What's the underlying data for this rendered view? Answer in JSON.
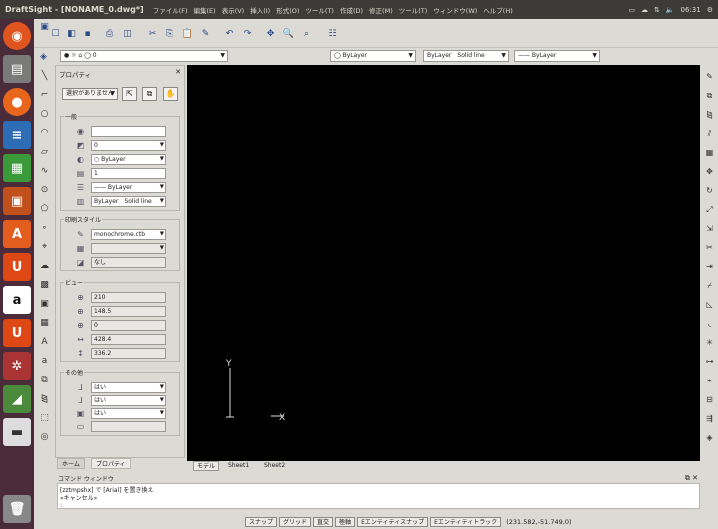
{
  "window": {
    "title": "DraftSight - [NONAME_0.dwg*]"
  },
  "menu": [
    "ファイル(F)",
    "編集(E)",
    "表示(V)",
    "挿入(I)",
    "形式(O)",
    "ツール(T)",
    "作成(D)",
    "修正(M)",
    "ツール(T)",
    "ウィンドウ(W)",
    "ヘルプ(H)"
  ],
  "tray": {
    "time": "06:31"
  },
  "toolbar": {
    "layer_combo": "0",
    "color_combo": "ByLayer",
    "linetype_combo": "ByLayer　Solid line",
    "lineweight_combo": "ByLayer"
  },
  "properties": {
    "title": "プロパティ",
    "selection": "選択がありません",
    "general": {
      "header": "一般",
      "color": "",
      "layer": "0",
      "color_value": "ByLayer",
      "linescale": "1",
      "lineweight": "ByLayer",
      "linetype": "ByLayer　Solid line"
    },
    "print_style": {
      "header": "印刷スタイル",
      "table": "monochrome.ctb",
      "style": "",
      "attached": "なし"
    },
    "view": {
      "header": "ビュー",
      "center_x": "210",
      "center_y": "148.5",
      "center_z": "0",
      "width": "428.4",
      "height": "336.2"
    },
    "other": {
      "header": "その他",
      "ucs_icon_on": "はい",
      "ucs_icon_origin": "はい",
      "ucs_per_view": "はい",
      "ucs_name": ""
    }
  },
  "panel_tabs": [
    "ホーム",
    "プロパティ"
  ],
  "model_tabs": [
    "モデル",
    "Sheet1",
    "Sheet2"
  ],
  "command": {
    "header": "コマンド ウィンドウ",
    "lines": [
      "[zztmpshx] で [Arial] を置き換え",
      "«キャンセル»",
      ":"
    ]
  },
  "status": {
    "buttons": [
      "スナップ",
      "グリッド",
      "直交",
      "極軸",
      "Eエンティティスナップ",
      "Eエンティティトラック"
    ],
    "coords": "(231.582,-51.749,0)"
  },
  "canvas": {
    "ucs_y": "Y",
    "ucs_x": "X"
  }
}
